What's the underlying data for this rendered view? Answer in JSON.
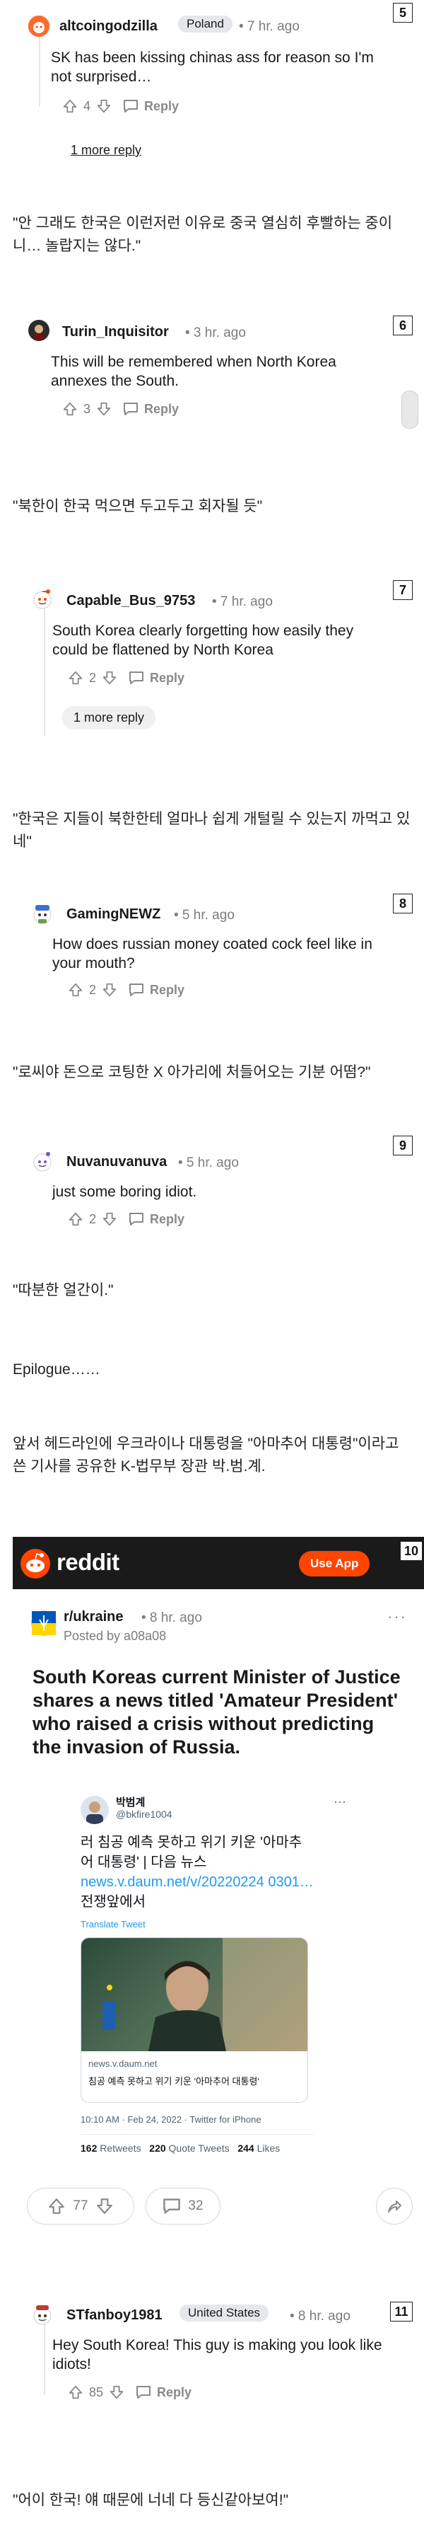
{
  "comments": [
    {
      "user": "altcoingodzilla",
      "flair": "Poland",
      "time": "• 7 hr. ago",
      "text": "SK has been kissing chinas ass for reason so I'm not surprised…",
      "votes": "4",
      "reply": "Reply",
      "more": "1 more reply",
      "num": "5"
    },
    {
      "user": "Turin_Inquisitor",
      "time": "• 3 hr. ago",
      "text": "This will be remembered when North Korea annexes the South.",
      "votes": "3",
      "reply": "Reply",
      "num": "6"
    },
    {
      "user": "Capable_Bus_9753",
      "time": "• 7 hr. ago",
      "text": "South Korea clearly forgetting how easily they could be flattened by North Korea",
      "votes": "2",
      "reply": "Reply",
      "more": "1 more reply",
      "num": "7"
    },
    {
      "user": "GamingNEWZ",
      "time": "• 5 hr. ago",
      "text": "How does russian money coated cock feel like in your mouth?",
      "votes": "2",
      "reply": "Reply",
      "num": "8"
    },
    {
      "user": "Nuvanuvanuva",
      "time": "• 5 hr. ago",
      "text": "just some boring idiot.",
      "votes": "2",
      "reply": "Reply",
      "num": "9"
    },
    {
      "user": "STfanboy1981",
      "flair": "United States",
      "time": "• 8 hr. ago",
      "text": "Hey South Korea! This guy is making you look like idiots!",
      "votes": "85",
      "reply": "Reply",
      "num": "11"
    }
  ],
  "translations": [
    "\"안 그래도 한국은 이런저런 이유로 중국 열심히 후빨하는 중이니… 놀랍지는 않다.\"",
    "\"북한이 한국 먹으면 두고두고 회자될 듯\"",
    "\"한국은 지들이 북한한테 얼마나 쉽게 개털릴 수 있는지 까먹고 있네\"",
    "\"로씨야 돈으로 코팅한 X 아가리에 처들어오는 기분 어떰?\"",
    "\"따분한 얼간이.\"",
    "\"어이 한국! 얘 때문에 너네 다 등신같아보여!\""
  ],
  "epilogue": {
    "title": "Epilogue……",
    "text": "앞서 헤드라인에 우크라이나 대통령을 \"아마추어 대통령\"이라고 쓴 기사를 공유한 K-법무부 장관 박.범.계."
  },
  "reddit_header": {
    "logo": "reddit",
    "button": "Use App",
    "num": "10"
  },
  "post": {
    "subreddit": "r/ukraine",
    "time": "• 8 hr. ago",
    "posted_by": "Posted by a08a08",
    "title": "South Koreas current Minister of Justice shares a news titled 'Amateur President' who raised a crisis without predicting the invasion of Russia.",
    "votes": "77",
    "comments": "32"
  },
  "tweet": {
    "name": "박범계",
    "handle": "@bkfire1004",
    "text": "러 침공 예측 못하고 위기 키운 '아마추어 대통령' | 다음 뉴스",
    "link": "news.v.daum.net/v/20220224 0301…",
    "trail": "전쟁앞에서",
    "translate": "Translate Tweet",
    "card_domain": "news.v.daum.net",
    "card_title": "침공 예측 못하고 위기 키운 '아마추어 대통령'",
    "footer": "10:10 AM · Feb 24, 2022 · Twitter for iPhone",
    "retweets": "162",
    "retweets_label": "Retweets",
    "quotes": "220",
    "quotes_label": "Quote Tweets",
    "likes": "244",
    "likes_label": "Likes",
    "dots": "···"
  },
  "colors": {
    "reddit_orange": "#ff4500",
    "reddit_header_bg": "#1a1a1b",
    "link_blue": "#1d9bf0",
    "meta_gray": "#7c7c7c"
  }
}
